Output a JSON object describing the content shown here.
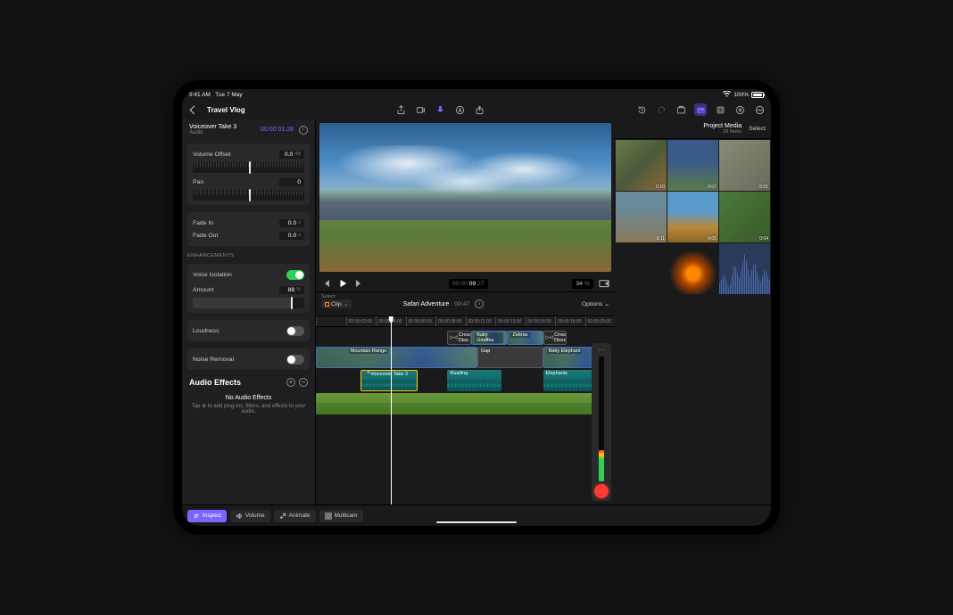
{
  "status": {
    "time": "9:41 AM",
    "date": "Tue 7 May",
    "battery": "100%"
  },
  "toolbar": {
    "project_title": "Travel Vlog"
  },
  "inspector": {
    "clip_name": "Voiceover Take 3",
    "clip_type": "Audio",
    "clip_tc": "00:00:01:28",
    "volume_offset": {
      "label": "Volume Offset",
      "value": "0.0",
      "unit": "dB"
    },
    "pan": {
      "label": "Pan",
      "value": "0"
    },
    "fade_in": {
      "label": "Fade In",
      "value": "0.0",
      "unit": "s"
    },
    "fade_out": {
      "label": "Fade Out",
      "value": "0.0",
      "unit": "s"
    },
    "enhancements_label": "ENHANCEMENTS",
    "voice_isolation": {
      "label": "Voice Isolation",
      "on": true
    },
    "amount": {
      "label": "Amount",
      "value": "88",
      "unit": "%"
    },
    "loudness": {
      "label": "Loudness",
      "on": false
    },
    "noise_removal": {
      "label": "Noise Removal",
      "on": false
    },
    "audio_effects": {
      "title": "Audio Effects",
      "empty_title": "No Audio Effects",
      "empty_sub": "Tap ⊕ to add plug-ins, filters, and effects to your audio."
    }
  },
  "transport": {
    "tc_dim": "00:00:",
    "tc_active": "09",
    "tc_frames": ":27",
    "zoom": "34",
    "zoom_unit": "%"
  },
  "timeline_header": {
    "select_label": "Select",
    "clip_label": "Clip",
    "project_name": "Safari Adventure",
    "duration": "00:47",
    "options_label": "Options"
  },
  "ruler": [
    "",
    "00:00:02:00",
    "00:00:04:00",
    "00:00:06:00",
    "00:00:08:00",
    "00:00:11:00",
    "00:00:13:00",
    "00:00:16:00",
    "00:00:18:00",
    "00:00:20:00"
  ],
  "clips": {
    "story_top": [
      {
        "type": "tr",
        "label": "Cross Diss…"
      },
      {
        "type": "vd",
        "label": "Baby Giraffes"
      },
      {
        "type": "vd",
        "label": "Zebras"
      },
      {
        "type": "tr",
        "label": "Cross Dissol…"
      }
    ],
    "primary": [
      {
        "type": "vd",
        "label": "Mountain Range"
      },
      {
        "type": "gap",
        "label": "Gap"
      },
      {
        "type": "vd",
        "label": "Baby Elephant"
      }
    ],
    "vo": {
      "label": "Voiceover Take 3"
    },
    "sfx": [
      {
        "label": "Rustling"
      },
      {
        "label": "Elephants"
      }
    ],
    "music": {
      "label": ""
    }
  },
  "browser": {
    "title": "Project Media",
    "sub": "28 Items",
    "select_label": "Select",
    "items": [
      {
        "dur": "0:10"
      },
      {
        "dur": "0:07"
      },
      {
        "dur": "0:01"
      },
      {
        "dur": "0:11"
      },
      {
        "dur": "0:05"
      },
      {
        "dur": "0:04"
      },
      {
        "dur": ""
      },
      {
        "dur": ""
      },
      {
        "dur": ""
      }
    ]
  },
  "bottom": {
    "inspect": "Inspect",
    "volume": "Volume",
    "animate": "Animate",
    "multicam": "Multicam"
  }
}
